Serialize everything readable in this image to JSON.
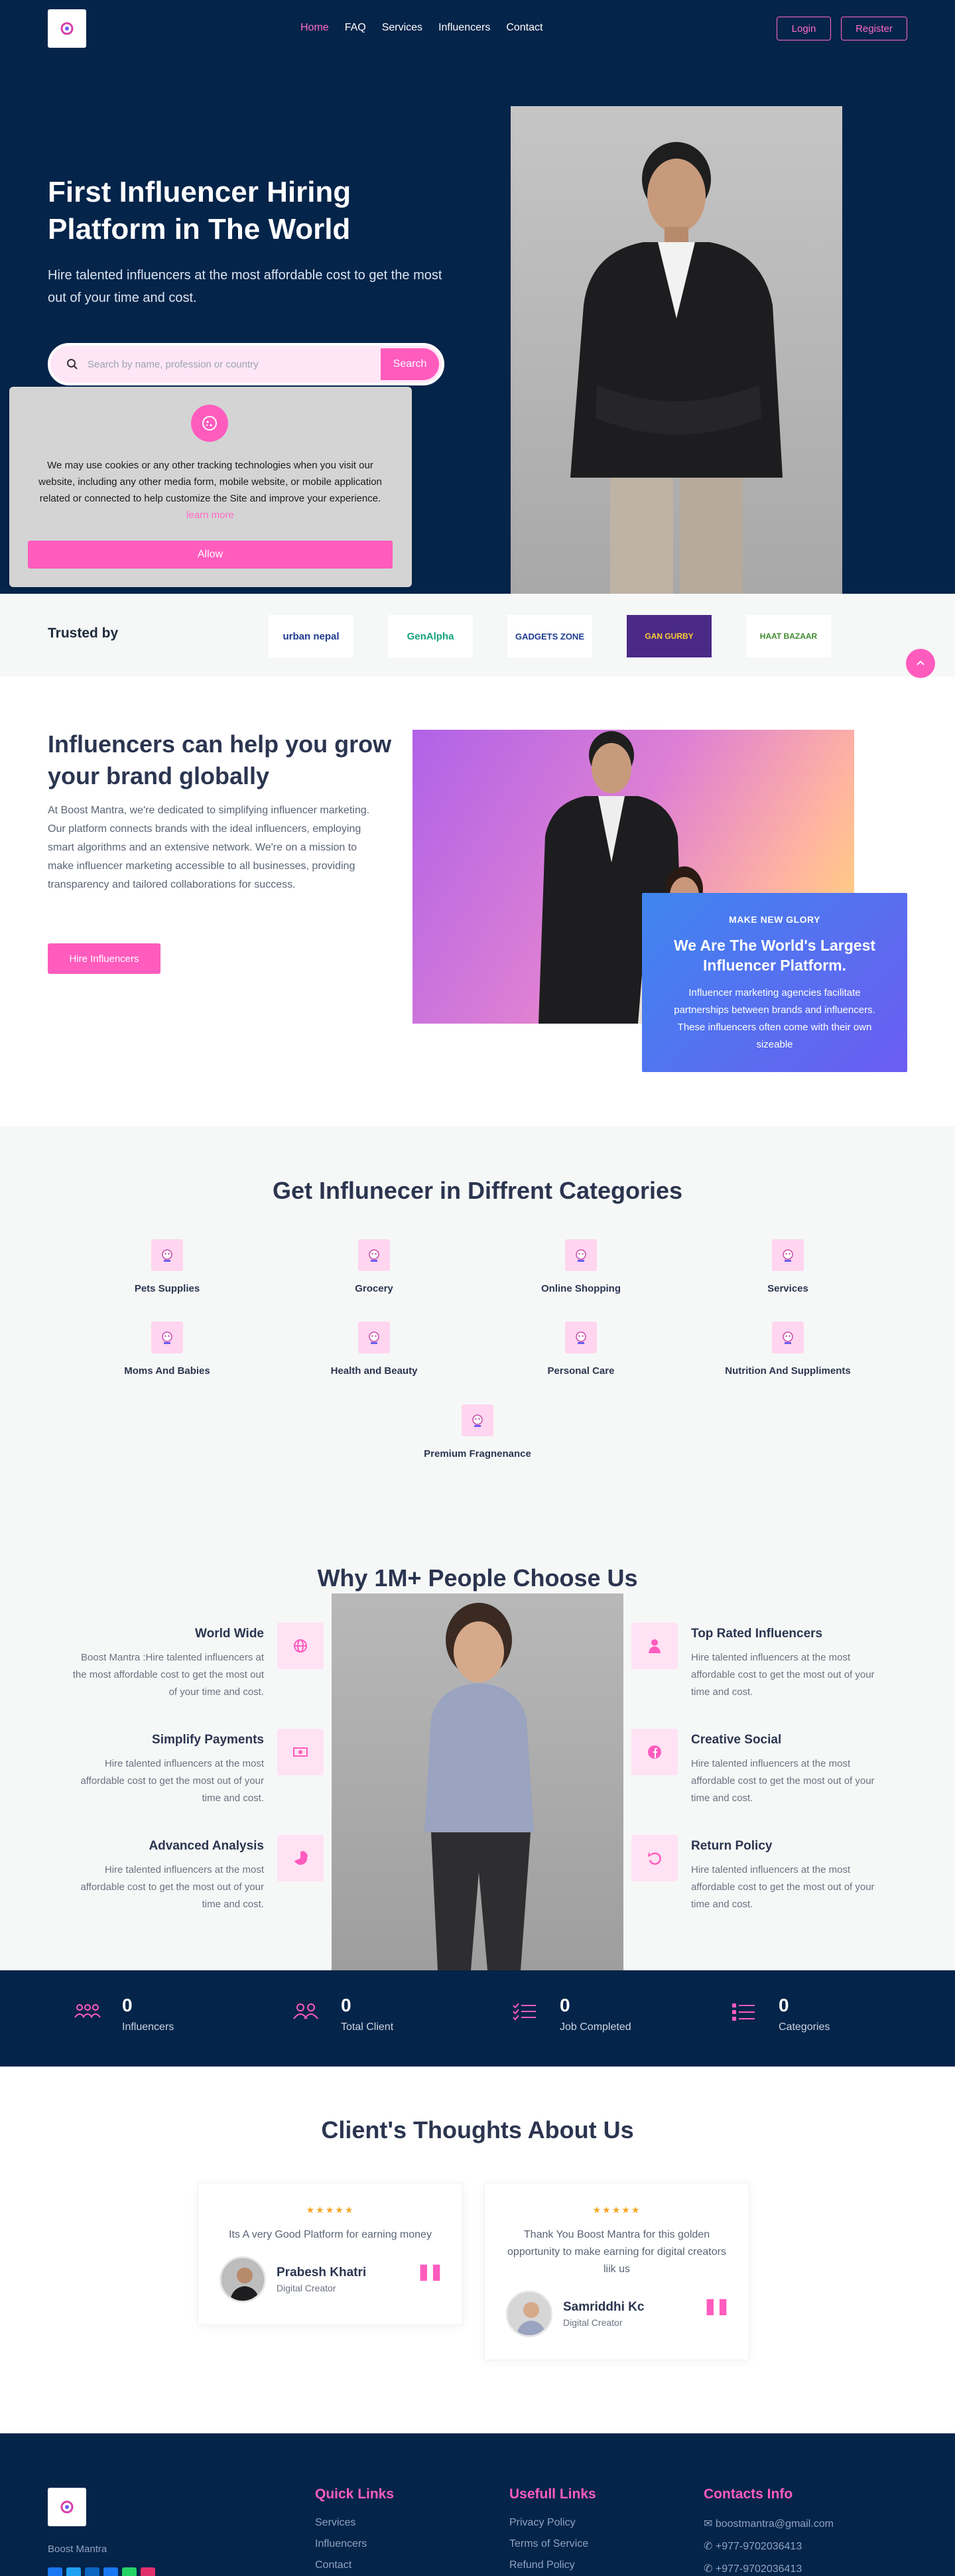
{
  "nav": {
    "items": [
      "Home",
      "FAQ",
      "Services",
      "Influencers",
      "Contact"
    ],
    "login": "Login",
    "register": "Register"
  },
  "hero": {
    "title": "First Influencer Hiring Platform in The World",
    "subtitle": "Hire talented influencers at the most affordable cost to get the most out of your time and cost.",
    "search_placeholder": "Search by name, profession or country",
    "search_button": "Search"
  },
  "cookie": {
    "text": "We may use cookies or any other tracking technologies when you visit our website, including any other media form, mobile website, or mobile application related or connected to help customize the Site and improve your experience.",
    "learn_more": "learn more",
    "allow": "Allow"
  },
  "trusted": {
    "label": "Trusted by",
    "logos": [
      "urban nepal",
      "GenAlpha",
      "GADGETS ZONE",
      "GAN GURBY",
      "HAAT BAZAAR"
    ]
  },
  "about": {
    "title": "Influencers can help you grow your brand globally",
    "text": "At Boost Mantra, we're dedicated to simplifying influencer marketing. Our platform connects brands with the ideal influencers, employing smart algorithms and an extensive network. We're on a mission to make influencer marketing accessible to all businesses, providing transparency and tailored collaborations for success.",
    "button": "Hire Influencers",
    "card_kicker": "MAKE NEW GLORY",
    "card_title": "We Are The World's Largest Influencer Platform.",
    "card_text": "Influencer marketing agencies facilitate partnerships between brands and influencers. These influencers often come with their own sizeable"
  },
  "categories": {
    "title": "Get Influnecer in Diffrent Categories",
    "items": [
      "Pets Supplies",
      "Grocery",
      "Online Shopping",
      "Services",
      "Moms And Babies",
      "Health and Beauty",
      "Personal Care",
      "Nutrition And Suppliments",
      "Premium Fragnenance"
    ]
  },
  "why": {
    "title": "Why 1M+ People Choose Us",
    "left": [
      {
        "title": "World Wide",
        "text": "Boost Mantra :Hire talented influencers at the most affordable cost to get the most out of your time and cost.",
        "icon": "globe-icon"
      },
      {
        "title": "Simplify Payments",
        "text": "Hire talented influencers at the most affordable cost to get the most out of your time and cost.",
        "icon": "money-icon"
      },
      {
        "title": "Advanced Analysis",
        "text": "Hire talented influencers at the most affordable cost to get the most out of your time and cost.",
        "icon": "pie-chart-icon"
      }
    ],
    "right": [
      {
        "title": "Top Rated Influencers",
        "text": "Hire talented influencers at the most affordable cost to get the most out of your time and cost.",
        "icon": "user-tie-icon"
      },
      {
        "title": "Creative Social",
        "text": "Hire talented influencers at the most affordable cost to get the most out of your time and cost.",
        "icon": "facebook-icon"
      },
      {
        "title": "Return Policy",
        "text": "Hire talented influencers at the most affordable cost to get the most out of your time and cost.",
        "icon": "undo-icon"
      }
    ]
  },
  "stats": [
    {
      "value": "0",
      "label": "Influencers"
    },
    {
      "value": "0",
      "label": "Total Client"
    },
    {
      "value": "0",
      "label": "Job Completed"
    },
    {
      "value": "0",
      "label": "Categories"
    }
  ],
  "testimonials": {
    "title": "Client's Thoughts About Us",
    "items": [
      {
        "stars": "★★★★★",
        "quote": "Its A very Good Platform for earning money",
        "name": "Prabesh Khatri",
        "role": "Digital Creator"
      },
      {
        "stars": "★★★★★",
        "quote": "Thank You Boost Mantra for this golden opportunity to make earning for digital creators liik us",
        "name": "Samriddhi Kc",
        "role": "Digital Creator"
      }
    ]
  },
  "footer": {
    "brand": "Boost Mantra",
    "quick_links": {
      "title": "Quick Links",
      "items": [
        "Services",
        "Influencers",
        "Contact"
      ]
    },
    "useful_links": {
      "title": "Usefull Links",
      "items": [
        "Privacy Policy",
        "Terms of Service",
        "Refund Policy"
      ]
    },
    "contact": {
      "title": "Contacts Info",
      "items": [
        "boostmantra@gmail.com",
        "+977-9702036413",
        "+977-9702036413"
      ]
    }
  },
  "colors": {
    "navy": "#04244a",
    "pink": "#ff5cbe",
    "light": "#f6f8f7"
  }
}
